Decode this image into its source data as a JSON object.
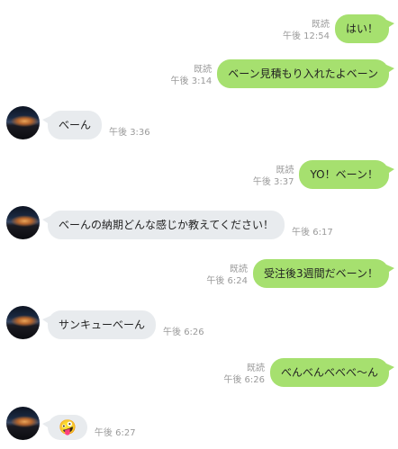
{
  "messages": [
    {
      "dir": "out",
      "text": "はい！",
      "read": "既読",
      "time": "午後 12:54"
    },
    {
      "dir": "out",
      "text": "ベーン見積もり入れたよベーン",
      "read": "既読",
      "time": "午後 3:14"
    },
    {
      "dir": "in",
      "text": "べーん",
      "time": "午後 3:36"
    },
    {
      "dir": "out",
      "text": "YO！ベーン！",
      "read": "既読",
      "time": "午後 3:37"
    },
    {
      "dir": "in",
      "text": "べーんの納期どんな感じか教えてください！",
      "time": "午後 6:17"
    },
    {
      "dir": "out",
      "text": "受注後3週間だベーン！",
      "read": "既読",
      "time": "午後 6:24"
    },
    {
      "dir": "in",
      "text": "サンキューべーん",
      "time": "午後 6:26"
    },
    {
      "dir": "out",
      "text": "べんべんべべべ〜ん",
      "read": "既読",
      "time": "午後 6:26"
    },
    {
      "dir": "in",
      "text": "🤪",
      "time": "午後 6:27"
    }
  ],
  "icons": {
    "avatar": "sunset-horizon-avatar"
  },
  "colors": {
    "outgoing_bubble": "#a6e06f",
    "incoming_bubble": "#e8ebee",
    "meta_text": "#9a9a9a"
  }
}
